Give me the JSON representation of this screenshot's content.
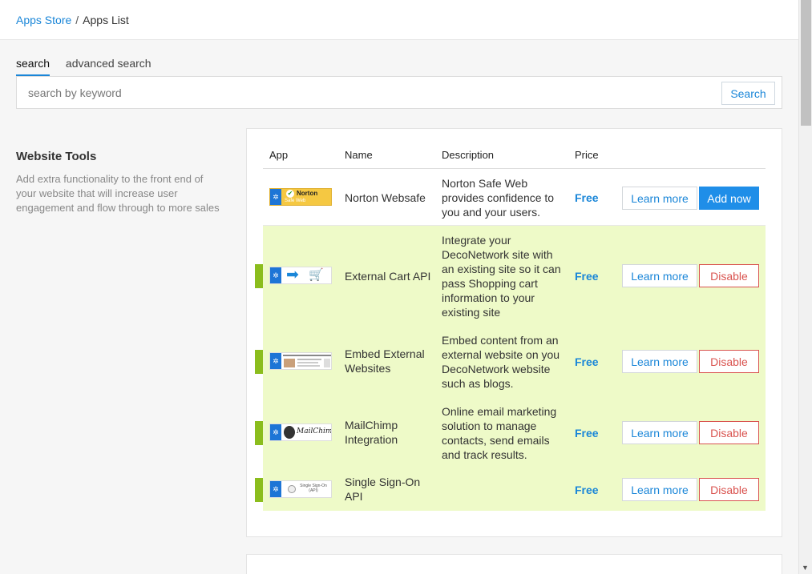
{
  "breadcrumb": {
    "root": "Apps Store",
    "separator": "/",
    "current": "Apps List"
  },
  "tabs": [
    {
      "label": "search",
      "active": true
    },
    {
      "label": "advanced search",
      "active": false
    }
  ],
  "search": {
    "placeholder": "search by keyword",
    "value": "",
    "button_label": "Search"
  },
  "section": {
    "title": "Website Tools",
    "description": "Add extra functionality to the front end of your website that will increase user engagement and flow through to more sales"
  },
  "table": {
    "headers": {
      "app": "App",
      "name": "Name",
      "description": "Description",
      "price": "Price"
    },
    "rows": [
      {
        "name": "Norton Websafe",
        "description": "Norton Safe Web provides confidence to you and your users.",
        "price": "Free",
        "learn_label": "Learn more",
        "action_label": "Add now",
        "enabled": false,
        "icon": "norton-safe-web-logo",
        "thumb_text": "Norton"
      },
      {
        "name": "External Cart API",
        "description": "Integrate your DecoNetwork site with an existing site so it can pass Shopping cart information to your existing site",
        "price": "Free",
        "learn_label": "Learn more",
        "action_label": "Disable",
        "enabled": true,
        "icon": "arrow-cart-icon",
        "thumb_text": ""
      },
      {
        "name": "Embed External Websites",
        "description": "Embed content from an external website on you DecoNetwork website such as blogs.",
        "price": "Free",
        "learn_label": "Learn more",
        "action_label": "Disable",
        "enabled": true,
        "icon": "website-screenshot",
        "thumb_text": ""
      },
      {
        "name": "MailChimp Integration",
        "description": "Online email marketing solution to manage contacts, send emails and track results.",
        "price": "Free",
        "learn_label": "Learn more",
        "action_label": "Disable",
        "enabled": true,
        "icon": "mailchimp-logo",
        "thumb_text": "MailChimp"
      },
      {
        "name": "Single Sign-On API",
        "description": "",
        "price": "Free",
        "learn_label": "Learn more",
        "action_label": "Disable",
        "enabled": true,
        "icon": "single-sign-on-logo",
        "thumb_text": "Single Sign-On (API)"
      }
    ]
  },
  "colors": {
    "accent": "#1a86d8",
    "enabled_row": "#eefac8",
    "enabled_flag": "#8bbd1d",
    "disable": "#d9534f",
    "deco_blue": "#1d75d6"
  }
}
